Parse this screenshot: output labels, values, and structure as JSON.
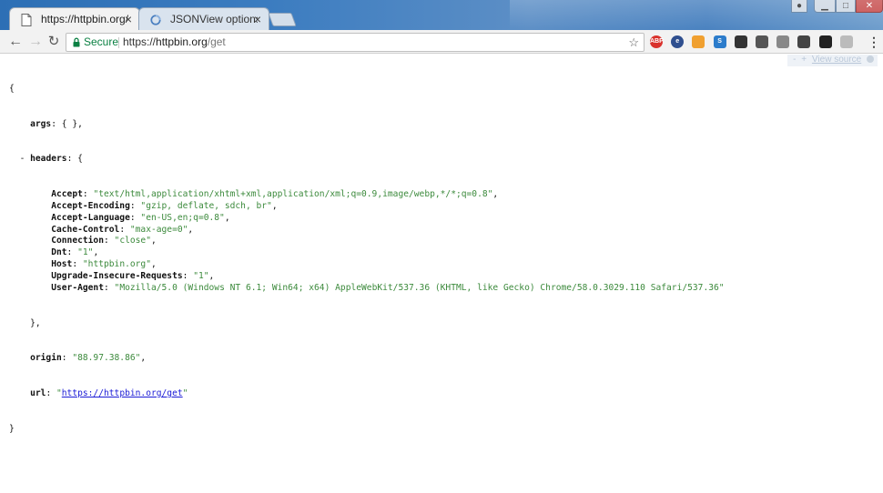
{
  "tabs": [
    {
      "label": "https://httpbin.org/get",
      "close": "×"
    },
    {
      "label": "JSONView options",
      "close": "×"
    }
  ],
  "toolbar": {
    "back": "←",
    "forward": "→",
    "reload": "↻",
    "secure_label": "Secure",
    "url_scheme": "https://",
    "url_host": "httpbin.org",
    "url_path": "/get",
    "star": "☆",
    "menu": "⋮"
  },
  "extensions": [
    {
      "name": "adblock-icon",
      "label": "ABP",
      "color": "#d9322d"
    },
    {
      "name": "e-extension-icon",
      "label": "e",
      "color": "#2f4f8f"
    },
    {
      "name": "mustache-extension-icon",
      "label": "",
      "color": "#f0a030"
    },
    {
      "name": "s-extension-icon",
      "label": "S",
      "color": "#2c7ccb"
    },
    {
      "name": "gear-extension-icon",
      "label": "",
      "color": "#333333"
    },
    {
      "name": "save-extension-icon",
      "label": "",
      "color": "#555555"
    },
    {
      "name": "drive-extension-icon",
      "label": "",
      "color": "#888888"
    },
    {
      "name": "pen-extension-icon",
      "label": "",
      "color": "#444444"
    },
    {
      "name": "glasses-extension-icon",
      "label": "",
      "color": "#222222"
    },
    {
      "name": "ghost-extension-icon",
      "label": "",
      "color": "#bbbbbb"
    }
  ],
  "viewsource": {
    "collapse": "-",
    "expand": "+",
    "label": "View source"
  },
  "json": {
    "open_brace": "{",
    "close_brace": "}",
    "args_key": "args",
    "args_value": "{ },",
    "headers_toggle": "-",
    "headers_key": "headers",
    "headers_close": "},",
    "headers": [
      {
        "key": "Accept",
        "value": "\"text/html,application/xhtml+xml,application/xml;q=0.9,image/webp,*/*;q=0.8\"",
        "comma": ","
      },
      {
        "key": "Accept-Encoding",
        "value": "\"gzip, deflate, sdch, br\"",
        "comma": ","
      },
      {
        "key": "Accept-Language",
        "value": "\"en-US,en;q=0.8\"",
        "comma": ","
      },
      {
        "key": "Cache-Control",
        "value": "\"max-age=0\"",
        "comma": ","
      },
      {
        "key": "Connection",
        "value": "\"close\"",
        "comma": ","
      },
      {
        "key": "Dnt",
        "value": "\"1\"",
        "comma": ","
      },
      {
        "key": "Host",
        "value": "\"httpbin.org\"",
        "comma": ","
      },
      {
        "key": "Upgrade-Insecure-Requests",
        "value": "\"1\"",
        "comma": ","
      },
      {
        "key": "User-Agent",
        "value": "\"Mozilla/5.0 (Windows NT 6.1; Win64; x64) AppleWebKit/537.36 (KHTML, like Gecko) Chrome/58.0.3029.110 Safari/537.36\"",
        "comma": ""
      }
    ],
    "origin_key": "origin",
    "origin_value": "\"88.97.38.86\"",
    "url_key": "url",
    "url_value": "https://httpbin.org/get"
  }
}
